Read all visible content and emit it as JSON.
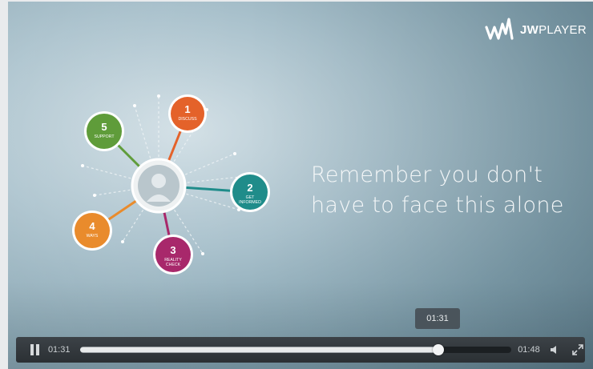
{
  "player": {
    "brand": {
      "logo_name": "jwplayer-logo",
      "text_bold": "JW",
      "text_regular": "PLAYER"
    },
    "slide": {
      "headline_line1": "Remember you don't",
      "headline_line2": "have to face this alone",
      "hub_icon": "person-icon",
      "steps": [
        {
          "number": "1",
          "label": "DISCUSS",
          "color": "#e4622a"
        },
        {
          "number": "2",
          "label": "GET INFORMED",
          "color": "#1f8c8a"
        },
        {
          "number": "3",
          "label": "REALITY CHECK",
          "color": "#a8286b"
        },
        {
          "number": "4",
          "label": "WAYS",
          "color": "#e98b2c"
        },
        {
          "number": "5",
          "label": "SUPPORT",
          "color": "#5f9c3a"
        }
      ]
    },
    "controls": {
      "state": "playing",
      "elapsed": "01:31",
      "duration": "01:48",
      "tooltip_time": "01:31",
      "progress": 0.83,
      "buffered": 0.84,
      "icons": [
        "pause-icon",
        "volume-icon",
        "fullscreen-icon"
      ]
    }
  }
}
